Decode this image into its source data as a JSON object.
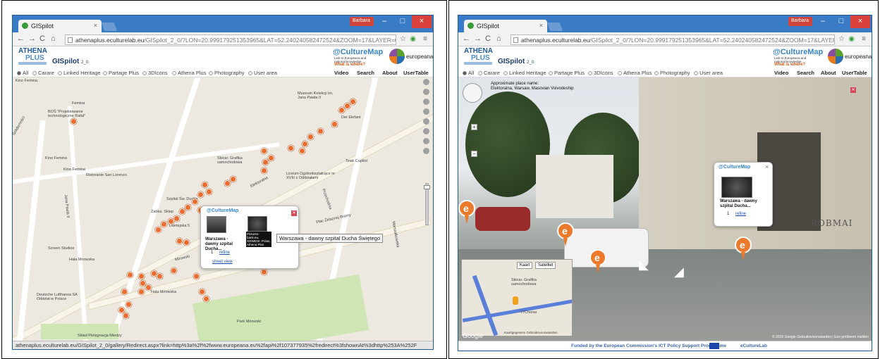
{
  "left": {
    "tab_title": "GISpilot",
    "url_host": "athenaplus.eculturelab.eu",
    "url_path": "/GISpilot_2_0/?LON=20.999179251353965&LAT=52.240240582472524&ZOOM=17&LAYER=0",
    "user_badge": "Barbara",
    "logo_athena": "ATHENA",
    "logo_plus": "PLUS",
    "app_name": "GISpilot",
    "app_version": "2_0",
    "culturemap": "@CultureMap",
    "culturemap_sub": "Link to Europeana and national knowledge",
    "what_where": "What is where?",
    "europeana": "europeana",
    "layers": [
      {
        "label": "All",
        "selected": true
      },
      {
        "label": "Carare",
        "selected": false
      },
      {
        "label": "Linked Heritage",
        "selected": false
      },
      {
        "label": "Partage Plus",
        "selected": false
      },
      {
        "label": "3DIcons",
        "selected": false
      },
      {
        "label": "Athena Plus",
        "selected": false
      },
      {
        "label": "Photography",
        "selected": false
      },
      {
        "label": "User area",
        "selected": false
      }
    ],
    "menu": [
      "Video",
      "Search",
      "About",
      "UserTable"
    ],
    "map_labels": [
      "Kino Femina",
      "Femina",
      "BOŚ \"Projektowanie technologiczne Rafał\"",
      "Muzeum Kolekcji im. Jana Pawła II",
      "Der Elefant",
      "Kino Femina",
      "Kino Femina",
      "Stiicar. Grafika samochodowa",
      "Liceum Ogólnokształcące nr XVIII z Oddziałami",
      "Teatr Capitol",
      "Ristorante San Lorenzo",
      "Szpital Św. Ducha",
      "Żabka. Sklep",
      "Elektoralna",
      "Dantejska 5",
      "Przechodnia",
      "Screen Studios",
      "Hala Mirowska",
      "Plac Żelaznej Bramy",
      "Deutsche Lufthansa SA Oddział w Polsce",
      "Hala Mirowska",
      "Park Mirowski",
      "Skład Pielęgnacja Miedzy",
      "Marszałkowska",
      "Solidarności",
      "Jana Pawła II",
      "Mirowski"
    ],
    "popup": {
      "header": "@CultureMap",
      "item1_title": "Warszawa - dawny szpital Ducha...",
      "item1_count": "1",
      "item1_link": "refine",
      "streetview_link": "street view",
      "item2_caption": "Pictures-bank.eu, XDIMESI. Polan, Athena Plus"
    },
    "tooltip": "Warszawa - dawny szpital Ducha Świętego",
    "status_url": "athenaplus.eculturelab.eu/GISpilot_2_0/gallery/Redirect.aspx?link=http%3a%2f%2fwww.europeana.eu%2fapi%2f107377935%2fredirect%3fshownAt%3dhttp%253A%252F"
  },
  "right": {
    "tab_title": "GISpilot",
    "url_host": "athenaplus.eculturelab.eu",
    "url_path": "/GISpilot_2_0/?LON=20.999179251353965&LAT=52.240240582472524&ZOOM=17&LAYER=0",
    "user_badge": "Barbara",
    "logo_athena": "ATHENA",
    "logo_plus": "PLUS",
    "app_name": "GISpilot",
    "app_version": "2_0",
    "culturemap": "@CultureMap",
    "culturemap_sub": "Link to Europeana and national knowledge",
    "what_where": "What is where?",
    "europeana": "europeana",
    "layers": [
      {
        "label": "All",
        "selected": true
      },
      {
        "label": "Carare",
        "selected": false
      },
      {
        "label": "Linked Heritage",
        "selected": false
      },
      {
        "label": "Partage Plus",
        "selected": false
      },
      {
        "label": "3DIcons",
        "selected": false
      },
      {
        "label": "Athena Plus",
        "selected": false
      },
      {
        "label": "Photography",
        "selected": false
      },
      {
        "label": "User area",
        "selected": false
      }
    ],
    "menu": [
      "Video",
      "Search",
      "About",
      "UserTable"
    ],
    "sv_place_label": "Approximate place name:",
    "sv_place_value": "Elektoralna, Warsaw, Masovian Voivodeship",
    "popup": {
      "header": "@CultureMap",
      "close": "×",
      "item_title": "Warszawa - dawny szpital Ducha...",
      "item_count": "1",
      "item_link": "refine"
    },
    "graffiti": "ROBMAI",
    "minimap_tab1": "Kaart",
    "minimap_tab2": "Satelliet",
    "minimap_label1": "Stiicar. Grafika samochodowa",
    "minimap_label2": "ITChorse",
    "minimap_copy": "Kaartgegevens   Gebruiksvoorwaarden",
    "google": "Google",
    "sv_copyright": "© 2015 Google   Gebruiksvoorwaarden | Een probleem melden",
    "footer_text": "Funded by the European Commission's ICT Policy Support Programme",
    "footer_lab": "eCultureLab"
  },
  "colors": {
    "marker": "#ec6b2d",
    "browser_frame": "#2d6fb3",
    "close_button": "#d9413a",
    "culturemap_blue": "#3a86c8",
    "park": "#cfe5b4"
  }
}
